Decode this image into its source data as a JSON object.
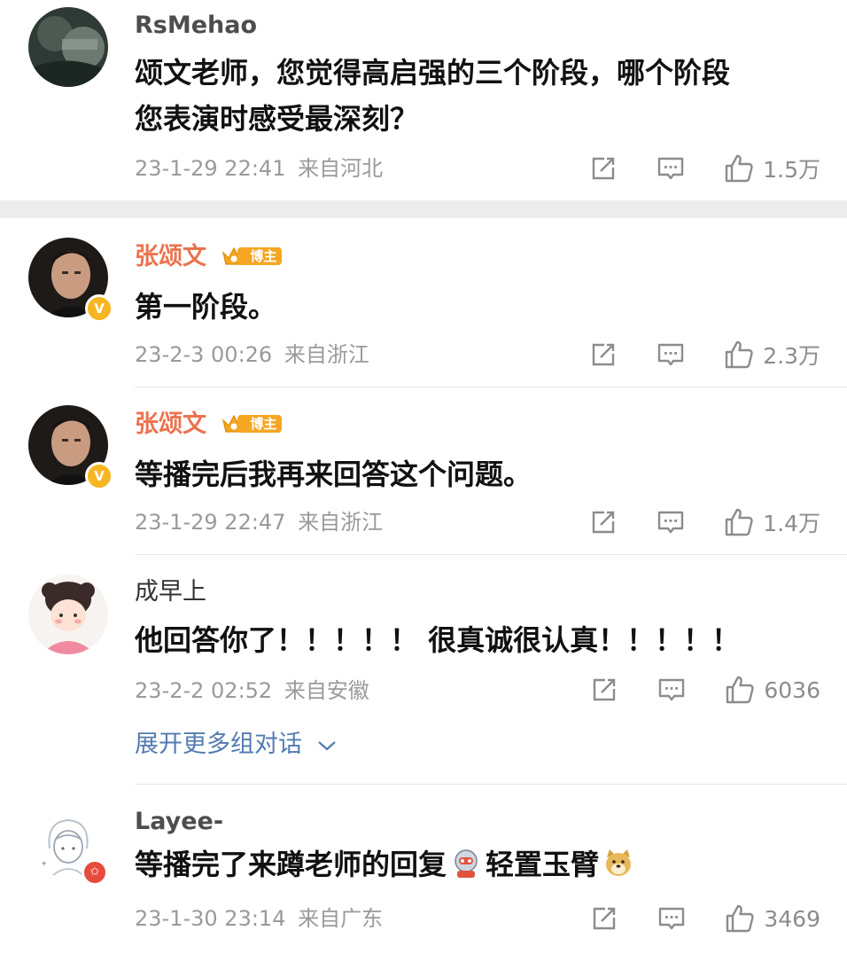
{
  "comments": [
    {
      "name": "RsMehao",
      "text_lines": [
        "颂文老师，您觉得高启强的三个阶段，哪个阶段",
        "您表演时感受最深刻？"
      ],
      "timestamp": "23-1-29 22:41",
      "location": "来自河北",
      "likes": "1.5万",
      "is_blogger": false
    },
    {
      "name": "张颂文",
      "badge_label": "博主",
      "text_lines": [
        "第一阶段。"
      ],
      "timestamp": "23-2-3 00:26",
      "location": "来自浙江",
      "likes": "2.3万",
      "verified_mark": "V",
      "is_blogger": true
    },
    {
      "name": "张颂文",
      "badge_label": "博主",
      "text_lines": [
        "等播完后我再来回答这个问题。"
      ],
      "timestamp": "23-1-29 22:47",
      "location": "来自浙江",
      "likes": "1.4万",
      "verified_mark": "V",
      "is_blogger": true
    },
    {
      "name": "成早上",
      "text_lines": [
        "他回答你了！！！！！ 很真诚很认真！！！！！"
      ],
      "timestamp": "23-2-2 02:52",
      "location": "来自安徽",
      "likes": "6036",
      "is_blogger": false
    },
    {
      "name": "Layee-",
      "text_parts": [
        "等播完了来蹲老师的回复",
        "轻置玉臂"
      ],
      "timestamp": "23-1-30 23:14",
      "location": "来自广东",
      "likes": "3469",
      "is_blogger": false
    }
  ],
  "expand_label": "展开更多组对话",
  "icons": [
    "share-icon",
    "comment-icon",
    "like-icon",
    "chevron-down-icon",
    "crown-icon",
    "robot-emoji-icon",
    "doge-emoji-icon"
  ],
  "colors": {
    "blogger_name": "#eb7350",
    "badge": "#f5a623",
    "verified": "#f8b522",
    "link": "#527bb0",
    "meta": "#9a9a9a"
  }
}
